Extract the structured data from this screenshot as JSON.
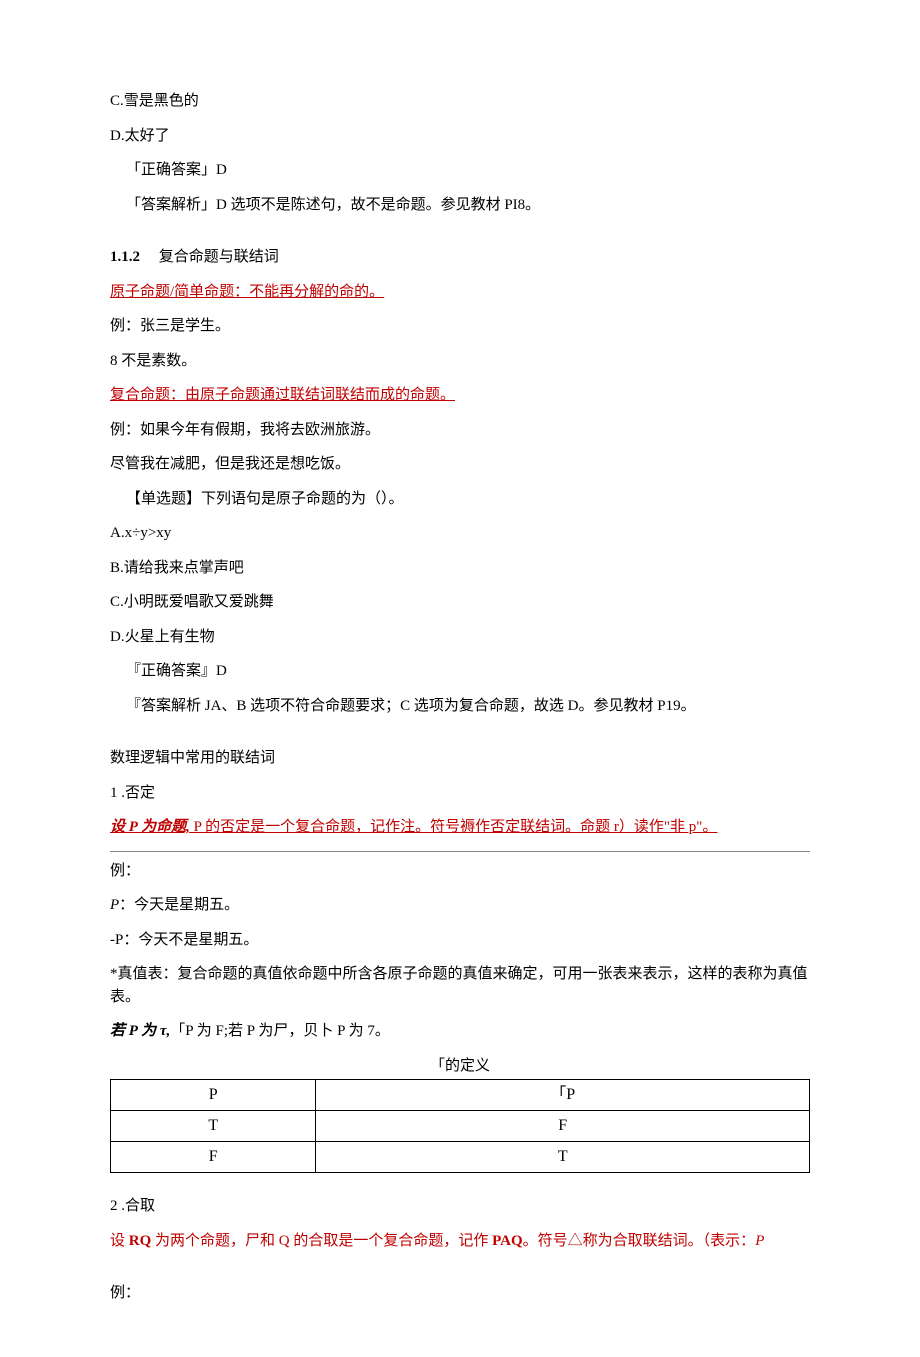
{
  "lines": {
    "opt_c": "C.雪是黑色的",
    "opt_d": "D.太好了",
    "ans_d": "「正确答案」D",
    "exp_d": "「答案解析」D 选项不是陈述句，故不是命题。参见教材 PI8。",
    "sec112_num": "1.1.2",
    "sec112_title": "复合命题与联结词",
    "atomic_def": "原子命题/简单命题：不能再分解的命的。",
    "ex1": "例：张三是学生。",
    "ex2": "8 不是素数。",
    "compound_def": "复合命题：由原子命题通过联结词联结而成的命题。",
    "ex3": "例：如果今年有假期，我将去欧洲旅游。",
    "ex4": "尽管我在减肥，但是我还是想吃饭。",
    "q_stem": "【单选题】下列语句是原子命题的为（）。",
    "q_a": "A.x÷y>xy",
    "q_b": "B.请给我来点掌声吧",
    "q_c": "C.小明既爱唱歌又爱跳舞",
    "q_d": "D.火星上有生物",
    "ans2": "『正确答案』D",
    "exp2": "『答案解析 JA、B 选项不符合命题要求；C 选项为复合命题，故选 D。参见教材 P19。",
    "conn_title": "数理逻辑中常用的联结词",
    "neg_num": "1 .否定",
    "neg_pre": "设 P 为命题,",
    "neg_def": " P 的否定是一个复合命题，记作注。符号褥作否定联结词。命题 r）读作\"非 p\"。",
    "ex_label": "例：",
    "neg_p1_pre": "P",
    "neg_p1": "：今天是星期五。",
    "neg_p2": "-P：今天不是星期五。",
    "truth": "*真值表：复合命题的真值依命题中所含各原子命题的真值来确定，可用一张表来表示，这样的表称为真值表。",
    "if_pre": "若 P 为 τ,",
    "if_body": "「P 为 F;若 P 为尸，贝卜 P 为 7。",
    "tbl_cap": "「的定义",
    "conj_num": "2 .合取",
    "conj_def_pre": "设 ",
    "conj_rq": "RQ",
    "conj_def_mid": " 为两个命题，尸和 Q 的合取是一个复合命题，记作 ",
    "conj_paq": "PAQ",
    "conj_def_suf": "。符号△称为合取联结词。（表示：",
    "conj_p": "P",
    "ex_final": "例："
  },
  "table": {
    "r1c1": "P",
    "r1c2": "「P",
    "r2c1": "T",
    "r2c2": "F",
    "r3c1": "F",
    "r3c2": "T"
  }
}
